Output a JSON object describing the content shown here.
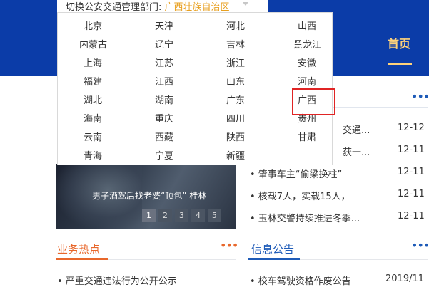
{
  "header": {
    "home_label": "首页"
  },
  "dropdown": {
    "label": "切换公安交通管理部门:",
    "current": "广西壮族自治区",
    "provinces": [
      "北京",
      "天津",
      "河北",
      "山西",
      "内蒙古",
      "辽宁",
      "吉林",
      "黑龙江",
      "上海",
      "江苏",
      "浙江",
      "安徽",
      "福建",
      "江西",
      "山东",
      "河南",
      "湖北",
      "湖南",
      "广东",
      "广西",
      "海南",
      "重庆",
      "四川",
      "贵州",
      "云南",
      "西藏",
      "陕西",
      "甘肃",
      "青海",
      "宁夏",
      "新疆"
    ],
    "highlighted": "广西"
  },
  "slider": {
    "caption": "男子酒驾后找老婆“顶包” 桂林",
    "pages": [
      "1",
      "2",
      "3",
      "4",
      "5"
    ],
    "active_page": "1"
  },
  "news": {
    "more": "•••",
    "items": [
      {
        "title": "交通...",
        "date": "12-12"
      },
      {
        "title": "获一...",
        "date": "12-11"
      },
      {
        "title": "• 肇事车主“偷梁换柱”",
        "date": "12-11"
      },
      {
        "title": "• 核载7人，实载15人，",
        "date": "12-11"
      },
      {
        "title": "• 玉林交警持续推进冬季...",
        "date": "12-11"
      }
    ]
  },
  "sections": {
    "left": {
      "title": "业务热点",
      "more": "•••",
      "first_item": "• 严重交通违法行为公开公示"
    },
    "right": {
      "title": "信息公告",
      "more": "•••",
      "first_item": "• 校车驾驶资格作废公告",
      "first_date": "2019/11"
    }
  },
  "colors": {
    "header_blue": "#0b3ca8",
    "accent_orange": "#e8672b",
    "link_blue": "#1e5bb8",
    "highlight_red": "#e02424",
    "current_gold": "#e8a020"
  }
}
